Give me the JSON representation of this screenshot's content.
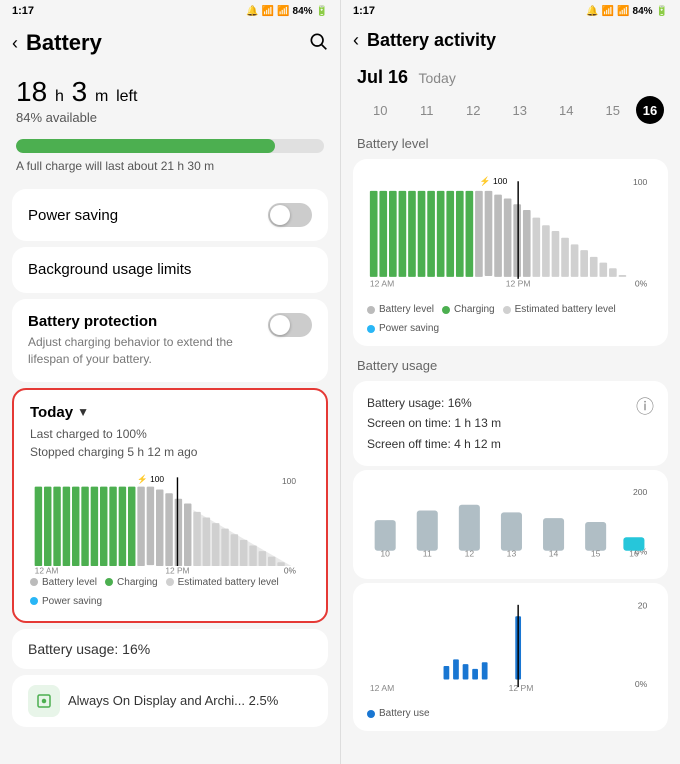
{
  "left": {
    "statusBar": {
      "time": "1:17",
      "battery": "84%",
      "icons": "🔔📶📶🔋"
    },
    "header": {
      "back": "‹",
      "title": "Battery",
      "search": "🔍"
    },
    "batteryTime": {
      "hours": "18",
      "h_unit": "h",
      "minutes": "3",
      "m_unit": "m",
      "left": "left",
      "available": "84% available"
    },
    "progressPercent": 84,
    "fullCharge": "A full charge will last about 21 h 30 m",
    "powerSaving": "Power saving",
    "backgroundUsage": "Background usage limits",
    "protection": {
      "title": "Battery protection",
      "desc": "Adjust charging behavior to extend the lifespan of your battery."
    },
    "today": {
      "label": "Today",
      "arrow": "▼",
      "stat1": "Last charged to 100%",
      "stat2": "Stopped charging 5 h 12 m ago",
      "chargeLabel": "⚡ 100"
    },
    "legend": {
      "batteryLevel": "Battery level",
      "estimatedLevel": "Estimated battery level",
      "charging": "Charging",
      "powerSaving": "Power saving"
    },
    "batteryUsage": "Battery usage: 16%",
    "alwaysOn": "Always On Display and Archi... 2.5%"
  },
  "right": {
    "statusBar": {
      "time": "1:17",
      "battery": "84%"
    },
    "header": {
      "back": "‹",
      "title": "Battery activity"
    },
    "date": {
      "label": "Jul 16",
      "sublabel": "Today"
    },
    "dateItems": [
      "10",
      "11",
      "12",
      "13",
      "14",
      "15",
      "16"
    ],
    "activeDate": "16",
    "batteryLevelTitle": "Battery level",
    "chargeLabel": "⚡ 100",
    "legend": {
      "batteryLevel": "Battery level",
      "estimatedLevel": "Estimated battery level",
      "charging": "Charging",
      "powerSaving": "Power saving"
    },
    "batteryUsageTitle": "Battery usage",
    "stats": {
      "usage": "Battery usage: 16%",
      "screenOn": "Screen on time: 1 h 13 m",
      "screenOff": "Screen off time: 4 h 12 m"
    },
    "barChartLabel": "200",
    "barChartZero": "0%",
    "barChartDates": [
      "10",
      "11",
      "12",
      "13",
      "14",
      "15",
      "16"
    ],
    "bottomChartLabel": "20",
    "bottomChartZero": "0%",
    "bottomChartLeft": "12 AM",
    "bottomChartRight": "12 PM",
    "bottomLegend": "Battery use"
  }
}
